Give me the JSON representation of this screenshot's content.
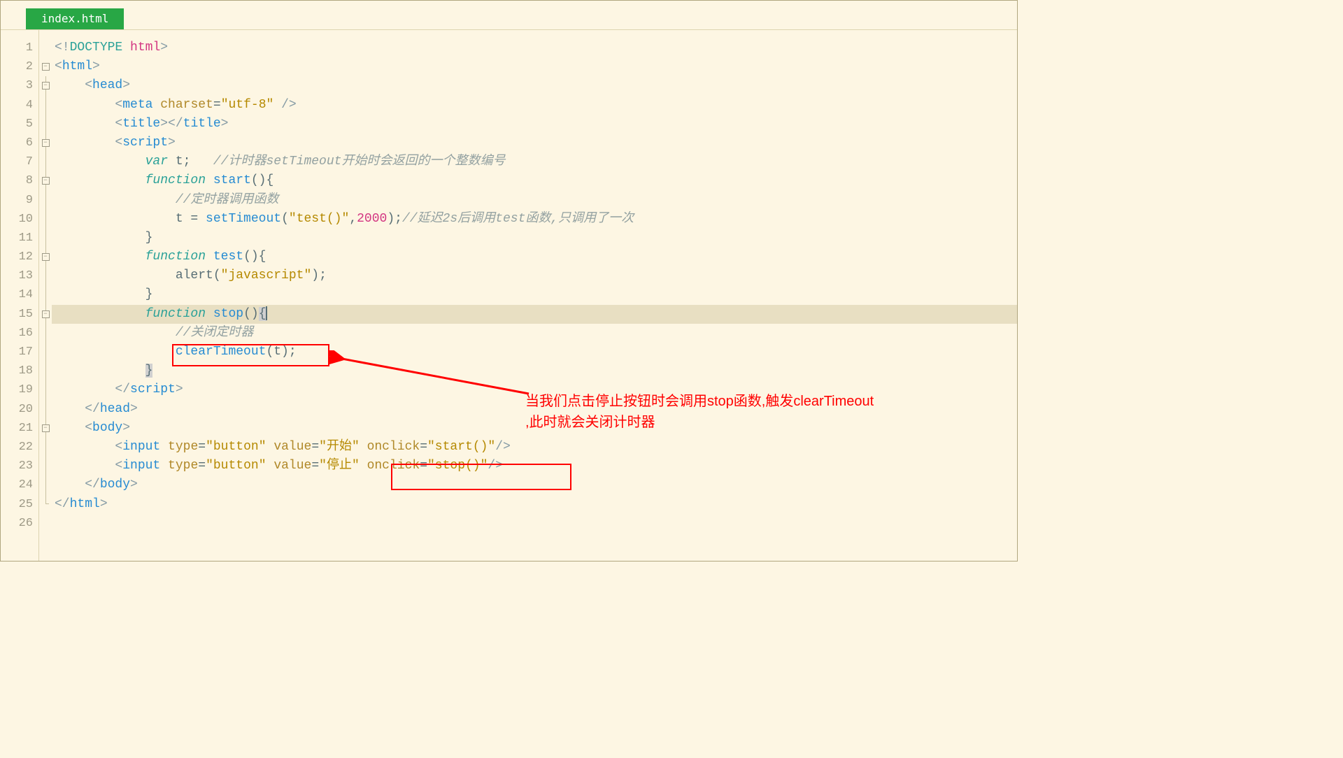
{
  "tab": {
    "filename": "index.html"
  },
  "gutter": {
    "lines": [
      "1",
      "2",
      "3",
      "4",
      "5",
      "6",
      "7",
      "8",
      "9",
      "10",
      "11",
      "12",
      "13",
      "14",
      "15",
      "16",
      "17",
      "18",
      "19",
      "20",
      "21",
      "22",
      "23",
      "24",
      "25",
      "26"
    ]
  },
  "fold": {
    "markers": {
      "2": "open",
      "3": "open",
      "6": "open",
      "8": "open",
      "12": "open",
      "15": "open",
      "21": "open"
    }
  },
  "code": {
    "l1": {
      "a": "<!",
      "b": "DOCTYPE",
      "c": " ",
      "d": "html",
      "e": ">"
    },
    "l2": {
      "a": "<",
      "b": "html",
      "c": ">"
    },
    "l3": {
      "a": "    <",
      "b": "head",
      "c": ">"
    },
    "l4": {
      "a": "        <",
      "b": "meta",
      "c": " ",
      "d": "charset",
      "e": "=",
      "f": "\"utf-8\"",
      "g": " />"
    },
    "l5": {
      "a": "        <",
      "b": "title",
      "c": "></",
      "d": "title",
      "e": ">"
    },
    "l6": {
      "a": "        <",
      "b": "script",
      "c": ">"
    },
    "l7": {
      "a": "            ",
      "b": "var",
      "c": " t;   ",
      "d": "//计时器setTimeout开始时会返回的一个整数编号"
    },
    "l8": {
      "a": "            ",
      "b": "function",
      "c": " ",
      "d": "start",
      "e": "(){"
    },
    "l9": {
      "a": "                ",
      "b": "//定时器调用函数"
    },
    "l10": {
      "a": "                t = ",
      "b": "setTimeout",
      "c": "(",
      "d": "\"test()\"",
      "e": ",",
      "f": "2000",
      "g": ");",
      "h": "//延迟2s后调用test函数,只调用了一次"
    },
    "l11": {
      "a": "            }"
    },
    "l12": {
      "a": "            ",
      "b": "function",
      "c": " ",
      "d": "test",
      "e": "(){"
    },
    "l13": {
      "a": "                alert(",
      "b": "\"javascript\"",
      "c": ");"
    },
    "l14": {
      "a": "            }"
    },
    "l15": {
      "a": "            ",
      "b": "function",
      "c": " ",
      "d": "stop",
      "e": "()",
      "f": "{"
    },
    "l16": {
      "a": "                ",
      "b": "//关闭定时器"
    },
    "l17": {
      "a": "                ",
      "b": "clearTimeout",
      "c": "(t);"
    },
    "l18": {
      "a": "            ",
      "b": "}"
    },
    "l19": {
      "a": "        </",
      "b": "script",
      "c": ">"
    },
    "l20": {
      "a": "    </",
      "b": "head",
      "c": ">"
    },
    "l21": {
      "a": "    <",
      "b": "body",
      "c": ">"
    },
    "l22": {
      "a": "        <",
      "b": "input",
      "c": " ",
      "d": "type",
      "e": "=",
      "f": "\"button\"",
      "g": " ",
      "h": "value",
      "i": "=",
      "j": "\"开始\"",
      "k": " ",
      "l": "onclick",
      "m": "=",
      "n": "\"start()\"",
      "o": "/>"
    },
    "l23": {
      "a": "        <",
      "b": "input",
      "c": " ",
      "d": "type",
      "e": "=",
      "f": "\"button\"",
      "g": " ",
      "h": "value",
      "i": "=",
      "j": "\"停止\"",
      "k": " ",
      "l": "onclick",
      "m": "=",
      "n": "\"stop()\"",
      "o": "/>"
    },
    "l24": {
      "a": "    </",
      "b": "body",
      "c": ">"
    },
    "l25": {
      "a": "</",
      "b": "html",
      "c": ">"
    },
    "l26": {
      "a": ""
    }
  },
  "annotation": {
    "text_line1": "当我们点击停止按钮时会调用stop函数,触发clearTimeout",
    "text_line2": ",此时就会关闭计时器"
  }
}
